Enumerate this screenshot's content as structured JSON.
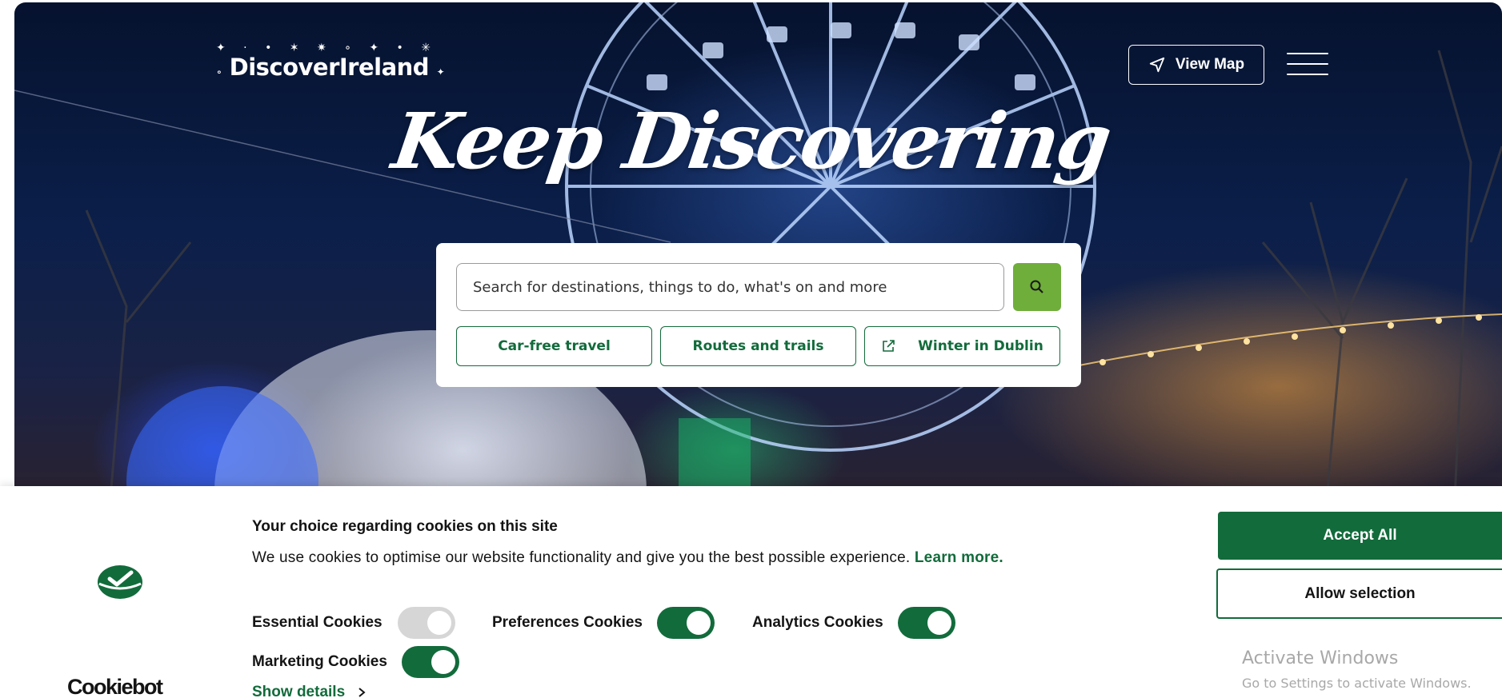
{
  "header": {
    "logo_text": "DiscoverIreland",
    "view_map_label": "View Map",
    "menu_icon": "hamburger-icon"
  },
  "hero": {
    "headline": "Keep Discovering"
  },
  "search": {
    "placeholder": "Search for destinations, things to do, what's on and more",
    "button_icon": "search-icon",
    "chips": [
      {
        "label": "Car-free travel"
      },
      {
        "label": "Routes and trails"
      },
      {
        "label": "Winter in Dublin",
        "icon": "external-link-icon"
      }
    ]
  },
  "cookie_banner": {
    "brand": "Cookiebot",
    "title": "Your choice regarding cookies on this site",
    "text": "We use cookies to optimise our website functionality and give you the best possible experience.",
    "learn_more": "Learn more.",
    "toggles": [
      {
        "label": "Essential Cookies",
        "on": true,
        "disabled": true
      },
      {
        "label": "Preferences Cookies",
        "on": true
      },
      {
        "label": "Analytics Cookies",
        "on": true
      },
      {
        "label": "Marketing Cookies",
        "on": true
      }
    ],
    "show_details": "Show details",
    "accept_all": "Accept All",
    "allow_selection": "Allow selection"
  },
  "watermark": {
    "title": "Activate Windows",
    "subtitle": "Go to Settings to activate Windows."
  },
  "colors": {
    "brand_green": "#126b3b",
    "search_green": "#6fae3a"
  }
}
